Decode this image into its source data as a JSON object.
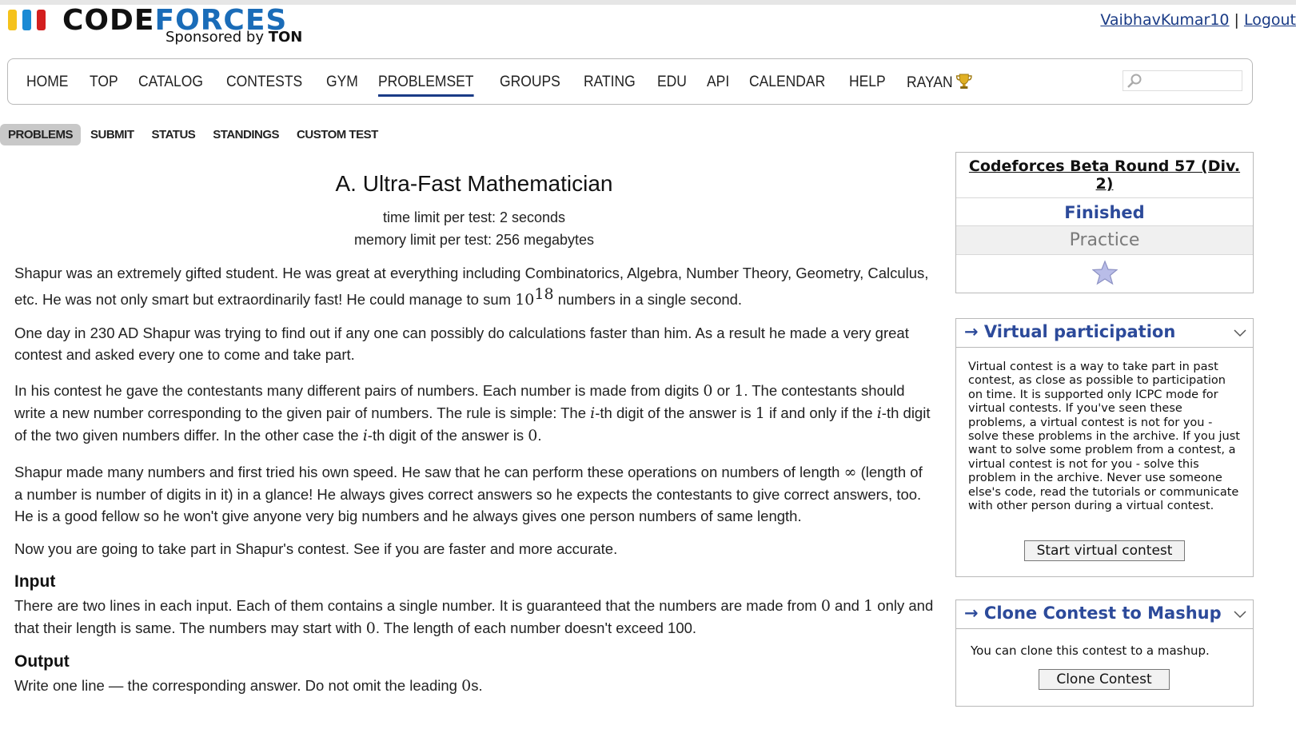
{
  "header": {
    "logo_word_a": "CODE",
    "logo_word_b": "FORCES",
    "sponsor_prefix": "Sponsored by",
    "sponsor_name": "TON",
    "username": "VaibhavKumar10",
    "separator": "|",
    "logout": "Logout"
  },
  "menu": {
    "items": [
      "HOME",
      "TOP",
      "CATALOG",
      "CONTESTS",
      "GYM",
      "PROBLEMSET",
      "GROUPS",
      "RATING",
      "EDU",
      "API",
      "CALENDAR",
      "HELP",
      "RAYAN"
    ],
    "active": "PROBLEMSET",
    "search_placeholder": ""
  },
  "submenu": {
    "items": [
      "PROBLEMS",
      "SUBMIT",
      "STATUS",
      "STANDINGS",
      "CUSTOM TEST"
    ],
    "active": "PROBLEMS"
  },
  "problem": {
    "title": "A. Ultra-Fast Mathematician",
    "time_limit": "time limit per test: 2 seconds",
    "memory_limit": "memory limit per test: 256 megabytes",
    "p1_a": "Shapur was an extremely gifted student. He was great at everything including Combinatorics, Algebra, Number Theory, Geometry, Calculus, etc. He was not only smart but extraordinarily fast! He could manage to sum ",
    "p1_base": "10",
    "p1_exp": "18",
    "p1_b": " numbers in a single second.",
    "p2": "One day in 230 AD Shapur was trying to find out if any one can possibly do calculations faster than him. As a result he made a very great contest and asked every one to come and take part.",
    "p3_a": "In his contest he gave the contestants many different pairs of numbers. Each number is made from digits ",
    "p3_m0": "0",
    "p3_b": " or ",
    "p3_m1": "1",
    "p3_c": ". The contestants should write a new number corresponding to the given pair of numbers. The rule is simple: The ",
    "p3_mi": "i",
    "p3_d": "-th digit of the answer is ",
    "p3_m1b": "1",
    "p3_e": " if and only if the ",
    "p3_mi2": "i",
    "p3_f": "-th digit of the two given numbers differ. In the other case the ",
    "p3_mi3": "i",
    "p3_g": "-th digit of the answer is ",
    "p3_m0b": "0",
    "p3_h": ".",
    "p4_a": "Shapur made many numbers and first tried his own speed. He saw that he can perform these operations on numbers of length ",
    "p4_inf": "∞",
    "p4_b": " (length of a number is number of digits in it) in a glance! He always gives correct answers so he expects the contestants to give correct answers, too. He is a good fellow so he won't give anyone very big numbers and he always gives one person numbers of same length.",
    "p5": "Now you are going to take part in Shapur's contest. See if you are faster and more accurate.",
    "input_title": "Input",
    "input_a": "There are two lines in each input. Each of them contains a single number. It is guaranteed that the numbers are made from ",
    "input_m0": "0",
    "input_b": " and ",
    "input_m1": "1",
    "input_c": " only and that their length is same. The numbers may start with ",
    "input_m0b": "0",
    "input_d": ". The length of each number doesn't exceed 100.",
    "output_title": "Output",
    "output_a": "Write one line — the corresponding answer. Do not omit the leading ",
    "output_m": "0",
    "output_b": "s."
  },
  "sidebar": {
    "contest_name": "Codeforces Beta Round 57 (Div. 2)",
    "status": "Finished",
    "mode": "Practice",
    "virtual": {
      "title": "→ Virtual participation",
      "description": "Virtual contest is a way to take part in past contest, as close as possible to participation on time. It is supported only ICPC mode for virtual contests. If you've seen these problems, a virtual contest is not for you - solve these problems in the archive. If you just want to solve some problem from a contest, a virtual contest is not for you - solve this problem in the archive. Never use someone else's code, read the tutorials or communicate with other person during a virtual contest.",
      "button": "Start virtual contest"
    },
    "clone": {
      "title": "→ Clone Contest to Mashup",
      "description": "You can clone this contest to a mashup.",
      "button": "Clone Contest"
    }
  },
  "colors": {
    "accent_blue": "#2c4a9a",
    "link_blue": "#1a3b86",
    "logo_yellow": "#f5c21b",
    "logo_blue": "#1a8ad4",
    "logo_red": "#d31f1f"
  }
}
